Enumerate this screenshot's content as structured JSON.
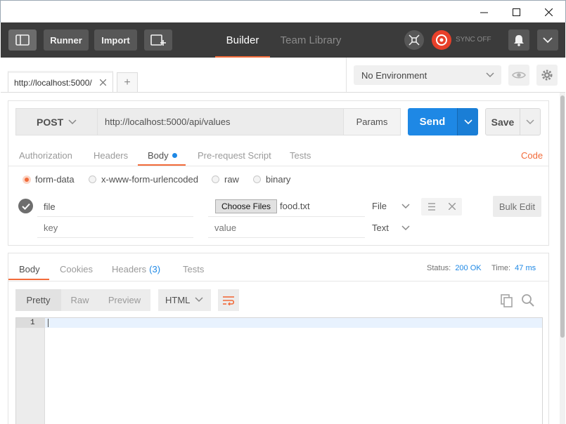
{
  "window": {
    "controls": [
      "minimize-icon",
      "maximize-icon",
      "close-icon"
    ]
  },
  "header": {
    "toggle_sidebar_icon": "sidebar-icon",
    "runner_label": "Runner",
    "import_label": "Import",
    "new_window_icon": "new-window-icon",
    "tabs": [
      {
        "label": "Builder",
        "active": true
      },
      {
        "label": "Team Library",
        "active": false
      }
    ],
    "interceptor_icon": "satellite-icon",
    "sync_label": "SYNC OFF",
    "sync_color": "#e8402a",
    "notifications_icon": "bell-icon",
    "menu_icon": "chevron-down-icon"
  },
  "tabs": {
    "open": [
      {
        "label": "http://localhost:5000/",
        "close_icon": "close-icon"
      }
    ],
    "add_label": "+"
  },
  "environment": {
    "selected": "No Environment",
    "quicklook_icon": "eye-icon",
    "settings_icon": "gear-icon"
  },
  "request": {
    "method": "POST",
    "url": "http://localhost:5000/api/values",
    "params_label": "Params",
    "send_label": "Send",
    "save_label": "Save",
    "accent": "#1e88e5",
    "subtabs": [
      {
        "label": "Authorization",
        "active": false
      },
      {
        "label": "Headers",
        "active": false
      },
      {
        "label": "Body",
        "active": true,
        "dot_color": "#1e88e5"
      },
      {
        "label": "Pre-request Script",
        "active": false
      },
      {
        "label": "Tests",
        "active": false
      }
    ],
    "code_label": "Code",
    "body_modes": [
      {
        "label": "form-data",
        "selected": true
      },
      {
        "label": "x-www-form-urlencoded",
        "selected": false
      },
      {
        "label": "raw",
        "selected": false
      },
      {
        "label": "binary",
        "selected": false
      }
    ],
    "form_rows": [
      {
        "checked": true,
        "key": "file",
        "file_button": "Choose Files",
        "file_name": "food.txt",
        "type": "File"
      },
      {
        "checked": false,
        "key_placeholder": "key",
        "value_placeholder": "value",
        "type": "Text"
      }
    ],
    "bulk_edit_label": "Bulk Edit"
  },
  "response": {
    "tabs": [
      {
        "label": "Body",
        "active": true
      },
      {
        "label": "Cookies",
        "active": false
      },
      {
        "label": "Headers",
        "count": "(3)",
        "active": false
      },
      {
        "label": "Tests",
        "active": false
      }
    ],
    "status_label": "Status:",
    "status_value": "200 OK",
    "time_label": "Time:",
    "time_value": "47 ms",
    "formats": [
      "Pretty",
      "Raw",
      "Preview"
    ],
    "language": "HTML",
    "wrap_icon": "wrap-lines-icon",
    "copy_icon": "copy-icon",
    "search_icon": "search-icon",
    "line_number": "1"
  }
}
